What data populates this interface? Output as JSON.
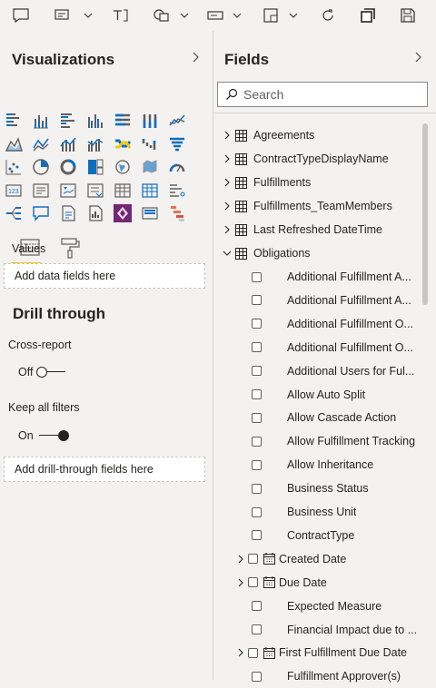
{
  "toolbar": {
    "icons": [
      "comment-icon",
      "format-dropdown-icon",
      "text-box-icon",
      "shapes-dropdown-icon",
      "buttons-dropdown-icon",
      "visual-table-dropdown-icon",
      "refresh-icon",
      "duplicate-icon",
      "save-icon"
    ]
  },
  "visualizations": {
    "title": "Visualizations",
    "values_label": "Values",
    "values_placeholder": "Add data fields here",
    "drill_through_title": "Drill through",
    "cross_report_label": "Cross-report",
    "cross_report_state": "Off",
    "keep_filters_label": "Keep all filters",
    "keep_filters_state": "On",
    "drill_placeholder": "Add drill-through fields here",
    "colors": {
      "accent": "#f2c811",
      "icon_blue": "#106ebe",
      "icon_gray": "#605e5c"
    }
  },
  "fields": {
    "title": "Fields",
    "search_placeholder": "Search",
    "tables": [
      {
        "name": "Agreements",
        "expanded": false
      },
      {
        "name": "ContractTypeDisplayName",
        "expanded": false
      },
      {
        "name": "Fulfillments",
        "expanded": false
      },
      {
        "name": "Fulfillments_TeamMembers",
        "expanded": false
      },
      {
        "name": "Last Refreshed DateTime",
        "expanded": false
      },
      {
        "name": "Obligations",
        "expanded": true
      }
    ],
    "obligation_fields": [
      {
        "name": "Additional Fulfillment A...",
        "type": "field"
      },
      {
        "name": "Additional Fulfillment A...",
        "type": "field"
      },
      {
        "name": "Additional Fulfillment O...",
        "type": "field"
      },
      {
        "name": "Additional Fulfillment O...",
        "type": "field"
      },
      {
        "name": "Additional Users for Ful...",
        "type": "field"
      },
      {
        "name": "Allow Auto Split",
        "type": "field"
      },
      {
        "name": "Allow Cascade Action",
        "type": "field"
      },
      {
        "name": "Allow Fulfillment Tracking",
        "type": "field"
      },
      {
        "name": "Allow Inheritance",
        "type": "field"
      },
      {
        "name": "Business Status",
        "type": "field"
      },
      {
        "name": "Business Unit",
        "type": "field"
      },
      {
        "name": "ContractType",
        "type": "field"
      },
      {
        "name": "Created Date",
        "type": "date"
      },
      {
        "name": "Due Date",
        "type": "date"
      },
      {
        "name": "Expected Measure",
        "type": "field"
      },
      {
        "name": "Financial Impact due to ...",
        "type": "field"
      },
      {
        "name": "First Fulfillment Due Date",
        "type": "date"
      },
      {
        "name": "Fulfillment Approver(s)",
        "type": "field"
      }
    ]
  }
}
